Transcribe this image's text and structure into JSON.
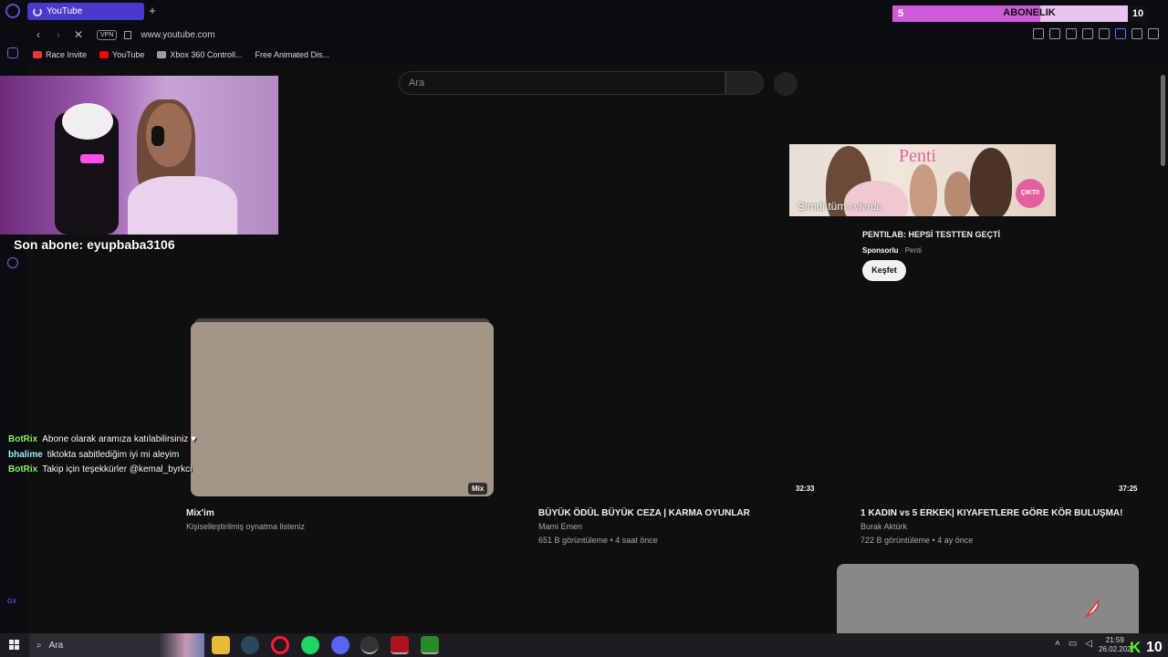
{
  "browser": {
    "tab_title": "YouTube",
    "new_tab_symbol": "+",
    "vpn_label": "VPN",
    "url": "www.youtube.com",
    "bookmarks": [
      {
        "label": "Race Invite",
        "color": "#e53935"
      },
      {
        "label": "YouTube",
        "color": "#ff0000"
      },
      {
        "label": "Xbox 360 Controll...",
        "color": "#9e9e9e"
      },
      {
        "label": "Free Animated Dis...",
        "color": "#0b0b12"
      }
    ]
  },
  "subscription_goal": {
    "current": "5",
    "label": "ABONELIK",
    "target": "10",
    "fill_fraction": 0.58
  },
  "youtube": {
    "search_placeholder": "Ara",
    "ad": {
      "brand": "Penti",
      "tagline_prefix": "Şimdi tüm",
      "tagline_italic": "evlerde.",
      "badge": "ÇIKTI!",
      "title": "PENTILAB: HEPSİ TESTTEN GEÇTİ",
      "sponsored": "Sponsorlu",
      "separator": "·",
      "advertiser": "Penti",
      "cta": "Keşfet"
    },
    "videos": [
      {
        "title": "Mix'im",
        "channel": "Kişiselleştirilmiş oynatma listeniz",
        "stats": "",
        "badge": "Mix"
      },
      {
        "title": "BÜYÜK ÖDÜL BÜYÜK CEZA | KARMA OYUNLAR",
        "channel": "Mami Emen",
        "stats": "651 B görüntüleme • 4 saat önce",
        "badge": "32:33"
      },
      {
        "title": "1 KADIN vs 5 ERKEK| KIYAFETLERE GÖRE KÖR BULUŞMA!",
        "channel": "Burak Aktürk",
        "stats": "722 B görüntüleme • 4 ay önce",
        "badge": "37:25"
      }
    ]
  },
  "stream_overlay": {
    "last_subscriber": "Son abone: eyupbaba3106",
    "chat": [
      {
        "user": "BotRix",
        "user_color": "#8ef26b",
        "message": "Abone olarak aramıza katılabilirsiniz ♥"
      },
      {
        "user": "bhalime",
        "user_color": "#9ef3ff",
        "message": "tiktokta sabitlediğim iyi mi aleyim"
      },
      {
        "user": "BotRix",
        "user_color": "#8ef26b",
        "message": "Takip için teşekkürler @kemal_byrkci"
      }
    ],
    "kick_badge": "K",
    "kick_number": "10"
  },
  "taskbar": {
    "search_placeholder": "Ara",
    "time": "21:59",
    "date": "26.02.202",
    "tray_icons": [
      "chevron-up-icon",
      "monitor-icon",
      "volume-icon",
      "message-icon"
    ]
  }
}
